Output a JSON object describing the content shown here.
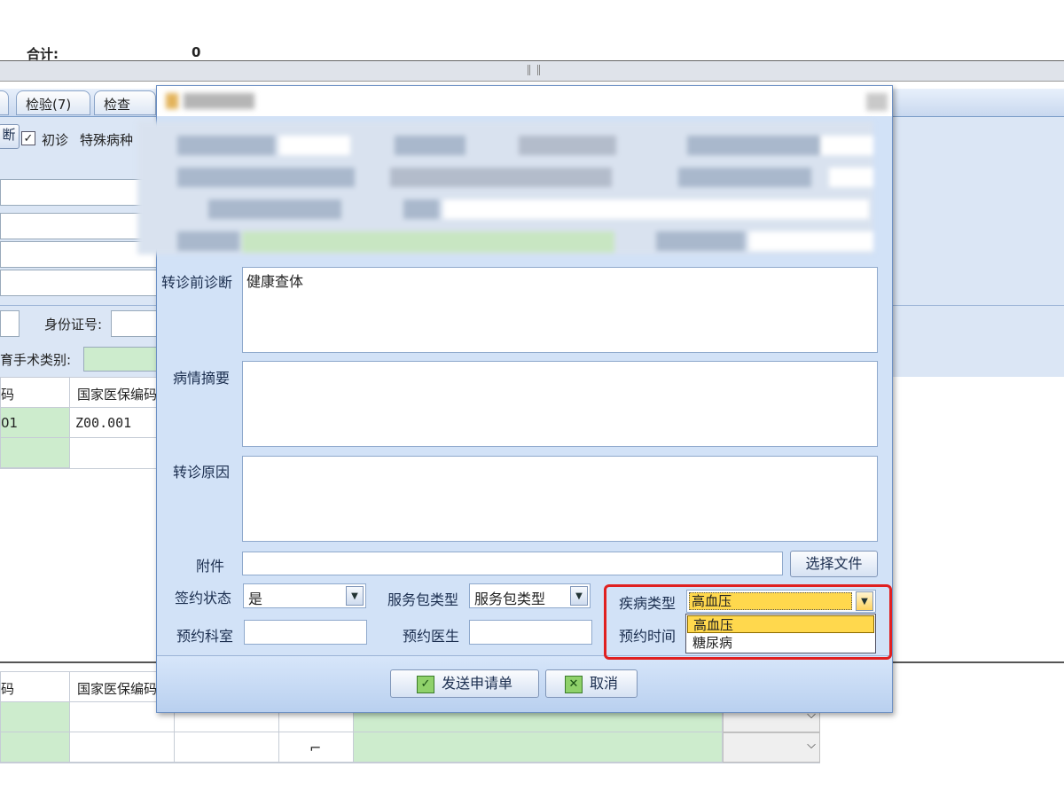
{
  "background": {
    "total_label": "合计:",
    "total_value": "0",
    "tabs": [
      "检验(7)",
      "检查"
    ],
    "diag_tab_label": "断",
    "first_visit_label": "初诊",
    "special_disease_label": "特殊病种",
    "id_number_label": "身份证号:",
    "surgery_type_label": "育手术类别:",
    "grid_headers": [
      "码",
      "国家医保编码"
    ],
    "grid_row1": [
      "01",
      "Z00.001"
    ],
    "lower_grid_headers": [
      "码",
      "国家医保编码"
    ]
  },
  "dialog": {
    "fields": {
      "pre_diagnosis_label": "转诊前诊断",
      "pre_diagnosis_value": "健康查体",
      "summary_label": "病情摘要",
      "summary_value": "",
      "reason_label": "转诊原因",
      "reason_value": "",
      "attachment_label": "附件",
      "attachment_value": "",
      "select_file_button": "选择文件",
      "sign_status_label": "签约状态",
      "sign_status_value": "是",
      "service_pkg_label": "服务包类型",
      "service_pkg_value": "服务包类型",
      "disease_type_label": "疾病类型",
      "disease_type_value": "高血压",
      "dept_label": "预约科室",
      "dept_value": "",
      "doctor_label": "预约医生",
      "doctor_value": "",
      "appt_time_label": "预约时间"
    },
    "dropdown_options": [
      "高血压",
      "糖尿病"
    ],
    "buttons": {
      "submit": "发送申请单",
      "cancel": "取消"
    }
  },
  "colors": {
    "dialog_bg": "#d2e2f7",
    "highlight": "#e02020",
    "selected_option": "#ffd84d",
    "green_cell": "#cdeccd"
  }
}
